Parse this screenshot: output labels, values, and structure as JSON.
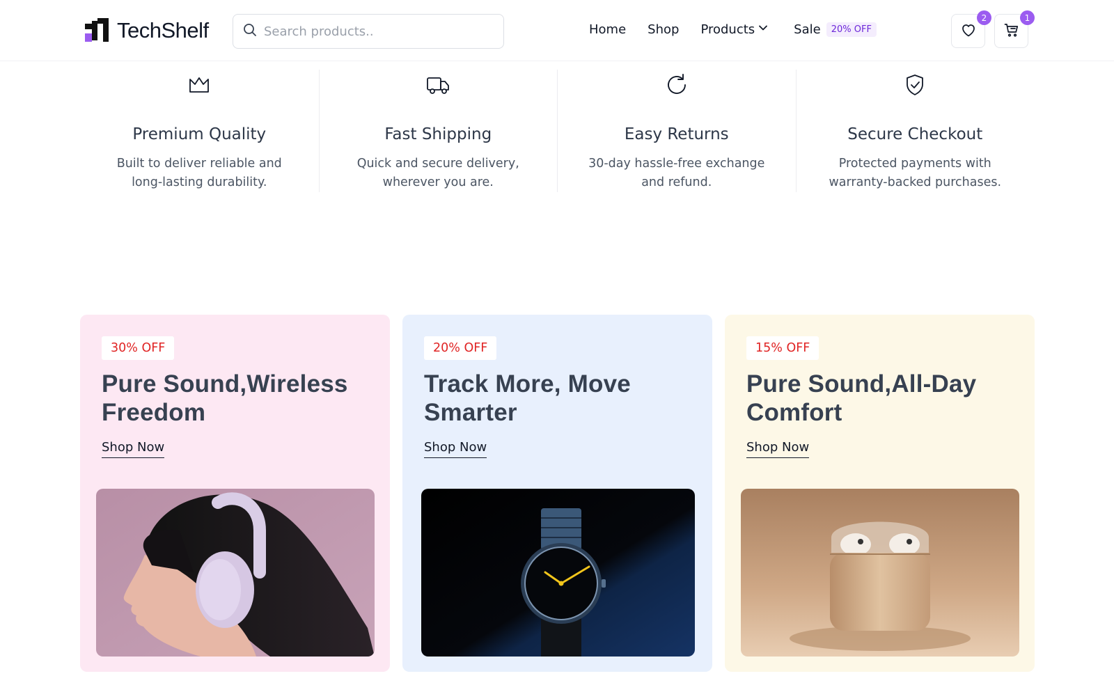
{
  "header": {
    "logo_text": "TechShelf",
    "search_placeholder": "Search products..",
    "nav": {
      "home": "Home",
      "shop": "Shop",
      "products": "Products",
      "sale": "Sale",
      "sale_badge": "20% OFF"
    },
    "wishlist_count": "2",
    "cart_count": "1"
  },
  "features": [
    {
      "icon": "crown-icon",
      "title": "Premium Quality",
      "line1": "Built to deliver reliable and",
      "line2": "long-lasting durability."
    },
    {
      "icon": "truck-icon",
      "title": "Fast Shipping",
      "line1": "Quick and secure delivery,",
      "line2": "wherever you are."
    },
    {
      "icon": "refresh-icon",
      "title": "Easy Returns",
      "line1": "30-day hassle-free exchange",
      "line2": "and refund."
    },
    {
      "icon": "shield-check-icon",
      "title": "Secure Checkout",
      "line1": "Protected payments with",
      "line2": "warranty-backed purchases."
    }
  ],
  "promos": [
    {
      "badge": "30% OFF",
      "title_line1": "Pure Sound,Wireless",
      "title_line2": "Freedom",
      "cta": "Shop Now",
      "bg": "#fde8f3",
      "image": "headphones-photo"
    },
    {
      "badge": "20% OFF",
      "title_line1": "Track More, Move",
      "title_line2": "Smarter",
      "cta": "Shop Now",
      "bg": "#e8f0fd",
      "image": "smartwatch-photo"
    },
    {
      "badge": "15% OFF",
      "title_line1": "Pure Sound,All-Day",
      "title_line2": "Comfort",
      "cta": "Shop Now",
      "bg": "#fdf8e7",
      "image": "earbuds-photo"
    }
  ],
  "colors": {
    "accent": "#9b5cf0",
    "discount_red": "#e02424",
    "text_dark": "#111827"
  }
}
